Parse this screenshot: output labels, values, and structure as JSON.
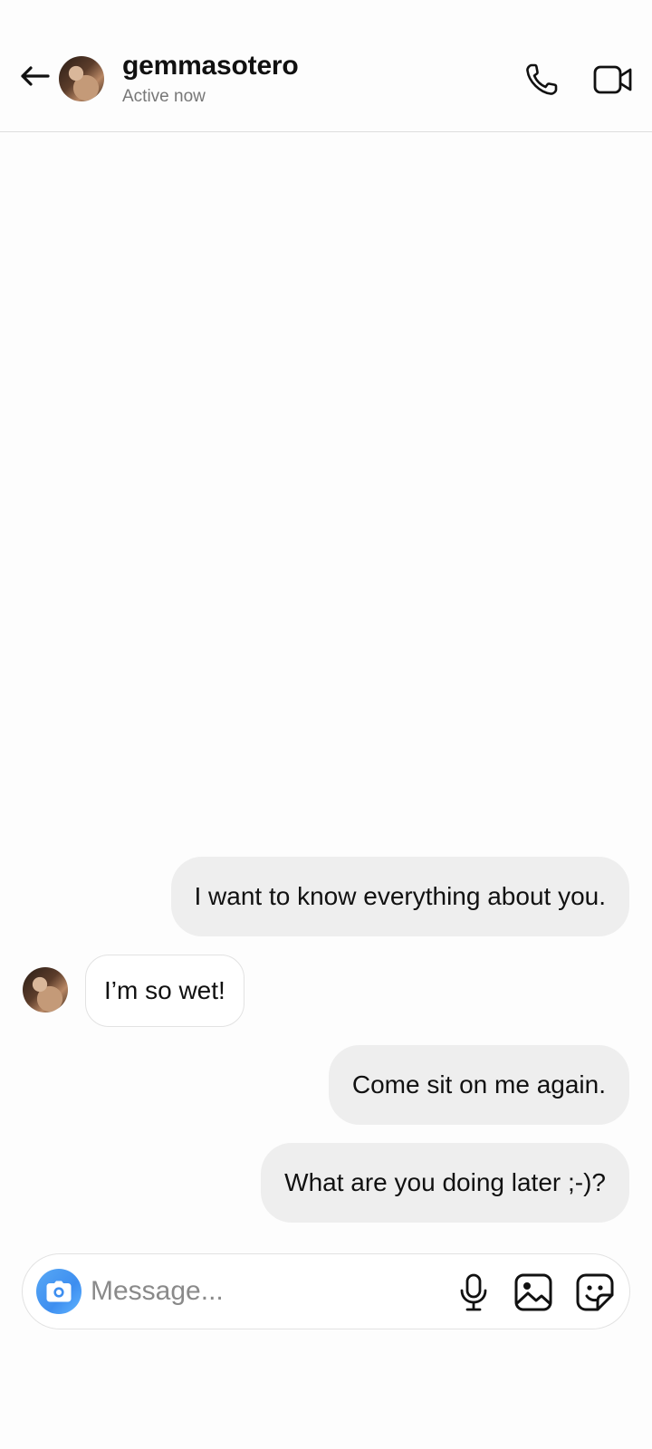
{
  "header": {
    "username": "gemmasotero",
    "status": "Active now",
    "icons": {
      "back": "arrow-left-icon",
      "call": "phone-icon",
      "video": "video-camera-icon"
    }
  },
  "messages": [
    {
      "direction": "outgoing",
      "text": "I want to know everything about you."
    },
    {
      "direction": "incoming",
      "text": "I’m so wet!"
    },
    {
      "direction": "outgoing",
      "text": "Come sit on me again."
    },
    {
      "direction": "outgoing",
      "text": "What are you doing later ;-)?"
    }
  ],
  "composer": {
    "placeholder": "Message...",
    "value": "",
    "icons": [
      "camera-icon",
      "microphone-icon",
      "image-icon",
      "sticker-icon"
    ]
  },
  "colors": {
    "outgoing_bubble": "#eeeeee",
    "incoming_border": "#e2e2e2",
    "camera_accent": "#3d8ef0",
    "status_text": "#777777"
  }
}
